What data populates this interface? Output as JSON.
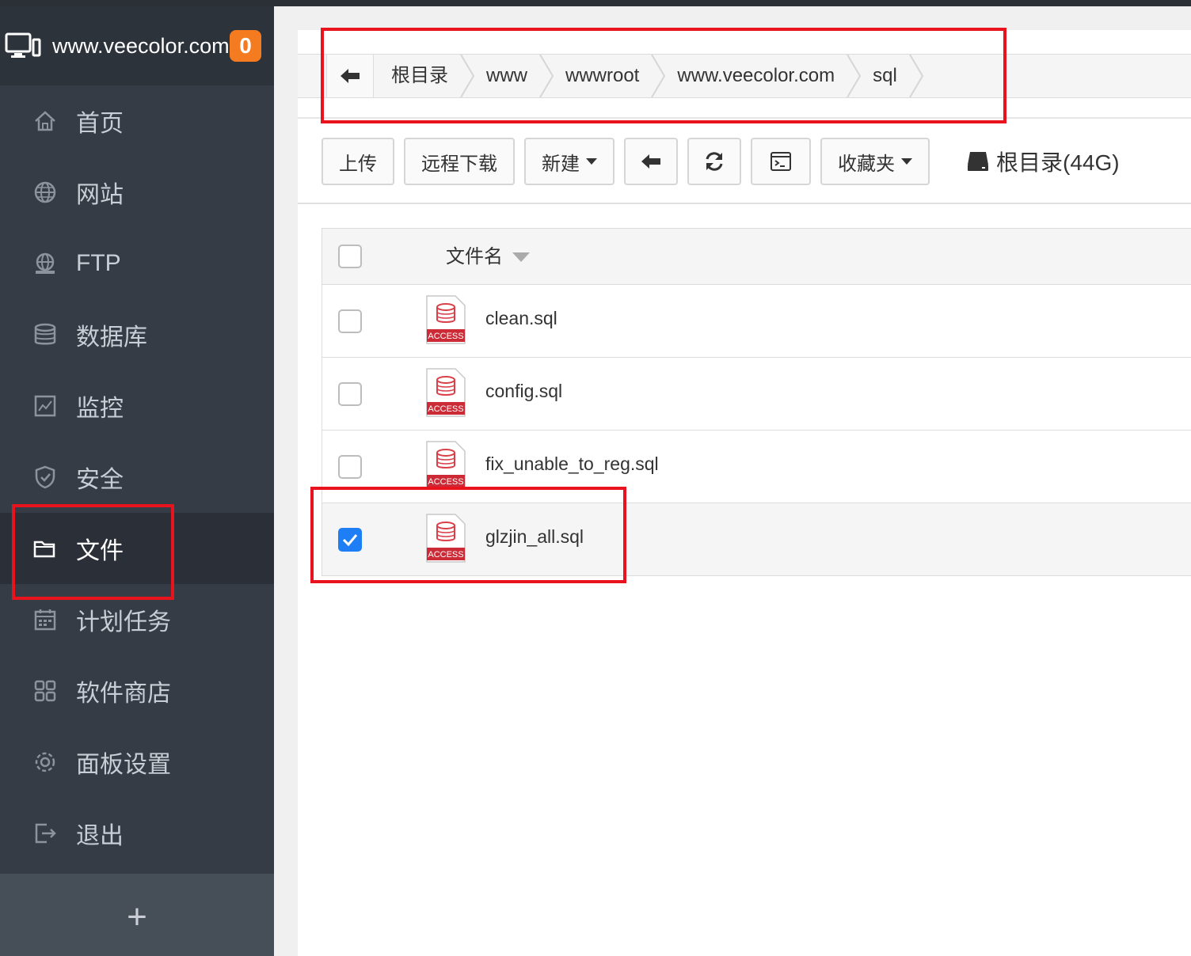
{
  "sidebar": {
    "site_name": "www.veecolor.com",
    "badge_count": "0",
    "items": [
      {
        "label": "首页",
        "icon": "home-icon"
      },
      {
        "label": "网站",
        "icon": "globe-icon"
      },
      {
        "label": "FTP",
        "icon": "ftp-icon"
      },
      {
        "label": "数据库",
        "icon": "database-icon"
      },
      {
        "label": "监控",
        "icon": "monitor-chart-icon"
      },
      {
        "label": "安全",
        "icon": "shield-icon"
      },
      {
        "label": "文件",
        "icon": "folder-icon",
        "active": true
      },
      {
        "label": "计划任务",
        "icon": "calendar-icon"
      },
      {
        "label": "软件商店",
        "icon": "apps-grid-icon"
      },
      {
        "label": "面板设置",
        "icon": "gear-icon"
      },
      {
        "label": "退出",
        "icon": "logout-icon"
      }
    ],
    "add_label": "+"
  },
  "breadcrumb": {
    "items": [
      "根目录",
      "www",
      "wwwroot",
      "www.veecolor.com",
      "sql"
    ]
  },
  "toolbar": {
    "upload": "上传",
    "remote_download": "远程下载",
    "new": "新建",
    "favorites": "收藏夹",
    "disk_label": "根目录(44G)"
  },
  "table": {
    "header_name": "文件名",
    "rows": [
      {
        "name": "clean.sql",
        "checked": false,
        "icon_text": "ACCESS"
      },
      {
        "name": "config.sql",
        "checked": false,
        "icon_text": "ACCESS"
      },
      {
        "name": "fix_unable_to_reg.sql",
        "checked": false,
        "icon_text": "ACCESS"
      },
      {
        "name": "glzjin_all.sql",
        "checked": true,
        "icon_text": "ACCESS"
      }
    ]
  },
  "colors": {
    "sidebar_bg": "#353c45",
    "sidebar_active": "#2b3038",
    "badge": "#f47b20",
    "highlight": "#e8131c",
    "checkbox_checked": "#1e7ef5"
  }
}
